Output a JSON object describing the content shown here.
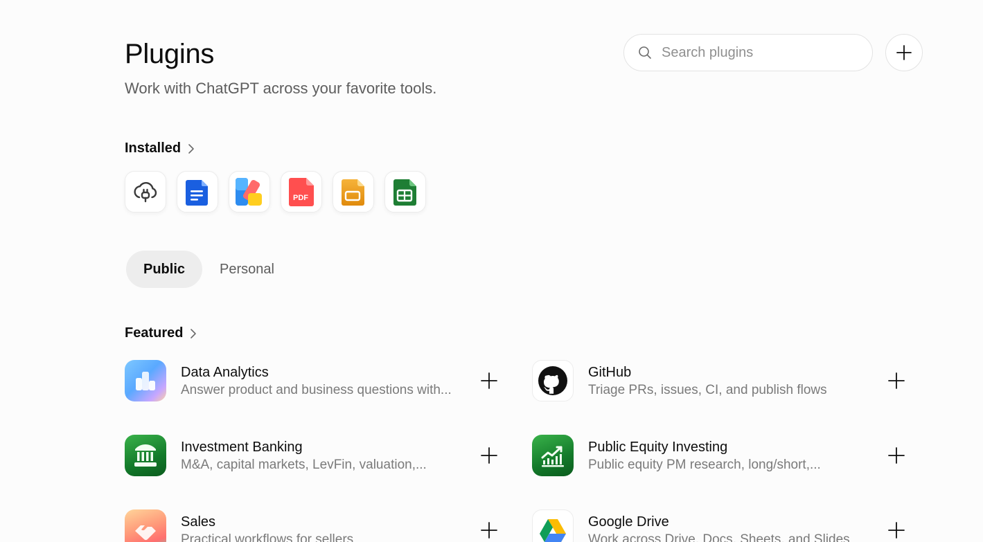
{
  "header": {
    "title": "Plugins",
    "subtitle": "Work with ChatGPT across your favorite tools."
  },
  "search": {
    "placeholder": "Search plugins",
    "icon": "search-icon"
  },
  "add_button": {
    "icon": "plus-icon"
  },
  "installed": {
    "heading": "Installed",
    "icons": [
      "cloud-plug-icon",
      "docs-icon",
      "design-icon",
      "pdf-icon",
      "slides-icon",
      "sheets-icon"
    ],
    "pdf_label": "PDF"
  },
  "tabs": [
    {
      "label": "Public",
      "active": true
    },
    {
      "label": "Personal",
      "active": false
    }
  ],
  "featured": {
    "heading": "Featured",
    "plugins": [
      {
        "name": "Data Analytics",
        "description": "Answer product and business questions with...",
        "icon": "data-analytics-icon"
      },
      {
        "name": "GitHub",
        "description": "Triage PRs, issues, CI, and publish flows",
        "icon": "github-icon"
      },
      {
        "name": "Investment Banking",
        "description": "M&A, capital markets, LevFin, valuation,...",
        "icon": "bank-icon"
      },
      {
        "name": "Public Equity Investing",
        "description": "Public equity PM research, long/short,...",
        "icon": "chart-up-icon"
      },
      {
        "name": "Sales",
        "description": "Practical workflows for sellers",
        "icon": "handshake-icon"
      },
      {
        "name": "Google Drive",
        "description": "Work across Drive, Docs, Sheets, and Slides",
        "icon": "google-drive-icon"
      }
    ]
  },
  "colors": {
    "background": "#fcfcfc",
    "text": "#0d0d0d",
    "muted": "#7a7a7a",
    "tab_active_bg": "#ededed"
  }
}
